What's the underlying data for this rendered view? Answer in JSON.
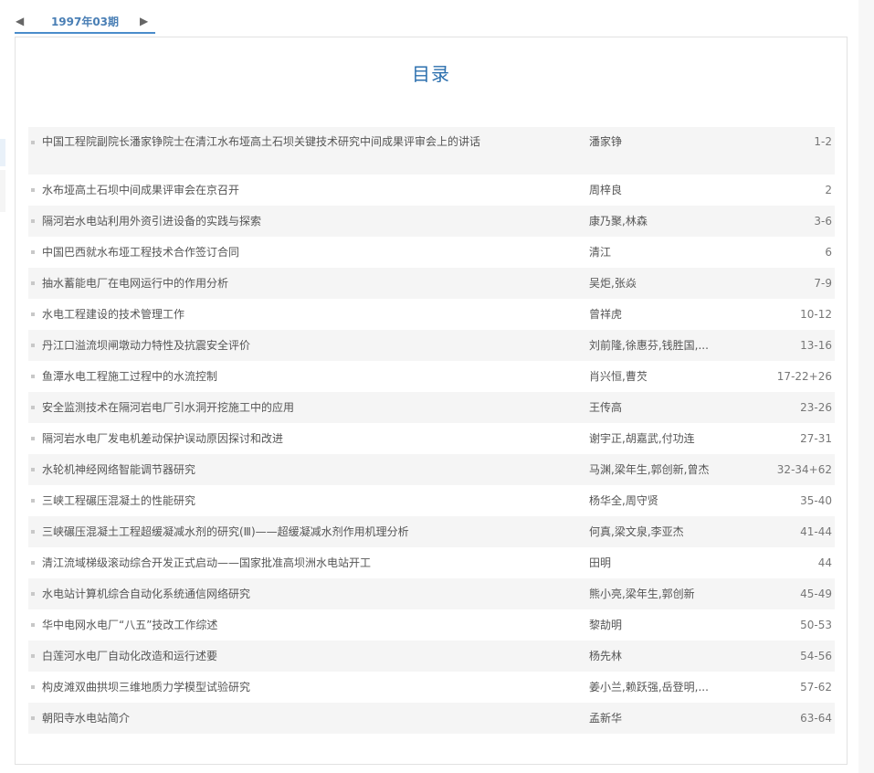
{
  "tabs": {
    "prev_icon": "◀",
    "next_icon": "▶",
    "active_label": "1997年03期"
  },
  "toc": {
    "title": "目录",
    "rows": [
      {
        "title": "中国工程院副院长潘家铮院士在清江水布垭高土石坝关键技术研究中间成果评审会上的讲话",
        "authors": "潘家铮",
        "pages": "1-2"
      },
      {
        "title": "水布垭高土石坝中间成果评审会在京召开",
        "authors": "周梓良",
        "pages": "2"
      },
      {
        "title": "隔河岩水电站利用外资引进设备的实践与探索",
        "authors": "康乃聚,林森",
        "pages": "3-6"
      },
      {
        "title": "中国巴西就水布垭工程技术合作签订合同",
        "authors": "清江",
        "pages": "6"
      },
      {
        "title": "抽水蓄能电厂在电网运行中的作用分析",
        "authors": "吴炬,张焱",
        "pages": "7-9"
      },
      {
        "title": "水电工程建设的技术管理工作",
        "authors": "曾祥虎",
        "pages": "10-12"
      },
      {
        "title": "丹江口溢流坝闸墩动力特性及抗震安全评价",
        "authors": "刘前隆,徐惠芬,钱胜国,...",
        "pages": "13-16"
      },
      {
        "title": "鱼潭水电工程施工过程中的水流控制",
        "authors": "肖兴恒,曹芡",
        "pages": "17-22+26"
      },
      {
        "title": "安全监测技术在隔河岩电厂引水洞开挖施工中的应用",
        "authors": "王传高",
        "pages": "23-26"
      },
      {
        "title": "隔河岩水电厂发电机差动保护误动原因探讨和改进",
        "authors": "谢宇正,胡嘉武,付功连",
        "pages": "27-31"
      },
      {
        "title": "水轮机神经网络智能调节器研究",
        "authors": "马渊,梁年生,郭创新,曾杰",
        "pages": "32-34+62"
      },
      {
        "title": "三峡工程碾压混凝土的性能研究",
        "authors": "杨华全,周守贤",
        "pages": "35-40"
      },
      {
        "title": "三峡碾压混凝土工程超缓凝减水剂的研究(Ⅲ)——超缓凝减水剂作用机理分析",
        "authors": "何真,梁文泉,李亚杰",
        "pages": "41-44"
      },
      {
        "title": "清江流域梯级滚动综合开发正式启动——国家批准高坝洲水电站开工",
        "authors": "田明",
        "pages": "44"
      },
      {
        "title": "水电站计算机综合自动化系统通信网络研究",
        "authors": "熊小亮,梁年生,郭创新",
        "pages": "45-49"
      },
      {
        "title": "华中电网水电厂“八五”技改工作综述",
        "authors": "黎劼明",
        "pages": "50-53"
      },
      {
        "title": "白莲河水电厂自动化改造和运行述要",
        "authors": "杨先林",
        "pages": "54-56"
      },
      {
        "title": "构皮滩双曲拱坝三维地质力学模型试验研究",
        "authors": "姜小兰,赖跃强,岳登明,...",
        "pages": "57-62"
      },
      {
        "title": "朝阳寺水电站简介",
        "authors": "孟新华",
        "pages": "63-64"
      }
    ]
  }
}
